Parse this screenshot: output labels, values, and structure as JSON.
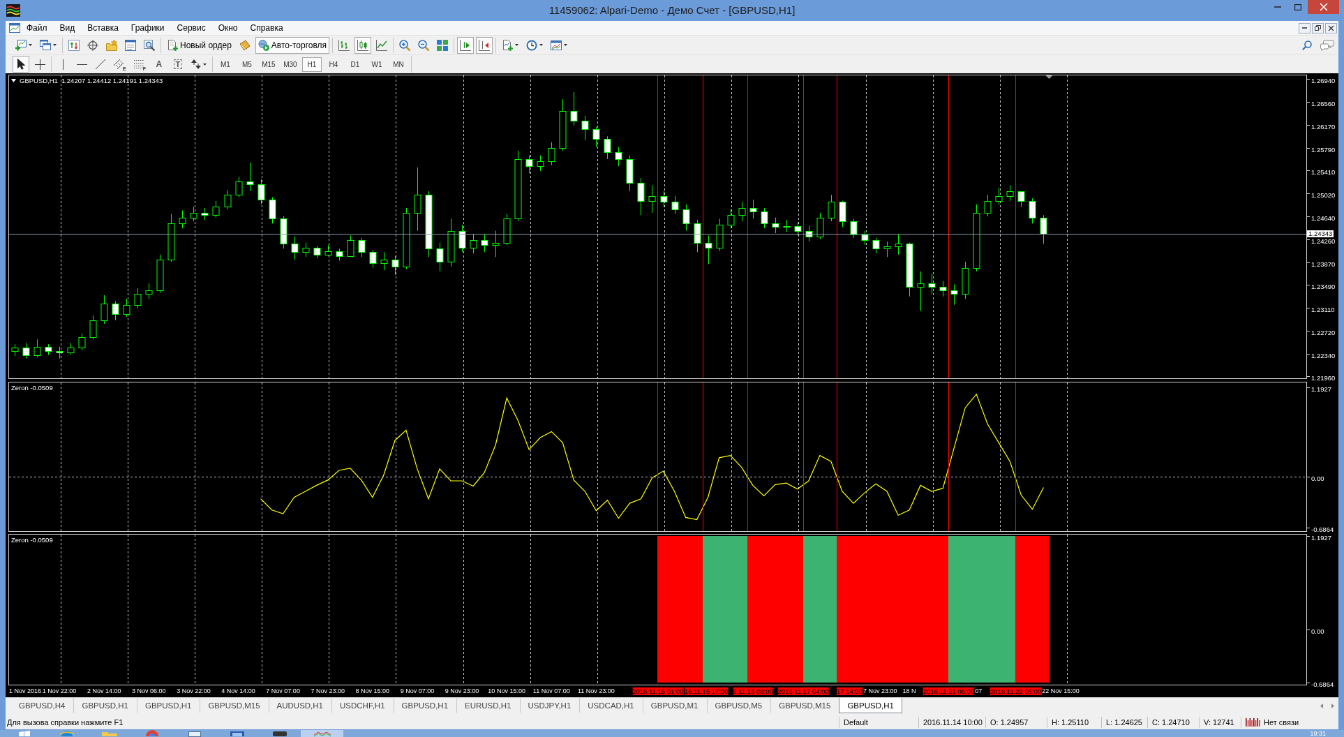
{
  "window": {
    "title": "11459062: Alpari-Demo - Демо Счет - [GBPUSD,H1]"
  },
  "menu": [
    "Файл",
    "Вид",
    "Вставка",
    "Графики",
    "Сервис",
    "Окно",
    "Справка"
  ],
  "main_toolbar": [
    [
      {
        "pressed": false,
        "dropdown": true
      },
      {
        "pressed": false,
        "dropdown": true
      }
    ],
    [
      {
        "pressed": false
      },
      {
        "pressed": false
      },
      {
        "pressed": false
      },
      {
        "pressed": false
      },
      {
        "pressed": false
      }
    ],
    [
      {
        "label": "Новый ордер",
        "pressed": false
      },
      {
        "pressed": false
      },
      {
        "label": "Авто-торговля",
        "pressed": true
      }
    ],
    [
      {
        "pressed": false
      },
      {
        "pressed": true
      },
      {
        "pressed": false
      }
    ],
    [
      {
        "pressed": false
      },
      {
        "pressed": false
      },
      {
        "pressed": false
      }
    ],
    [
      {
        "pressed": true
      },
      {
        "pressed": true
      }
    ],
    [
      {
        "pressed": false,
        "dropdown": true
      },
      {
        "pressed": false,
        "dropdown": true
      },
      {
        "pressed": false,
        "dropdown": true
      }
    ]
  ],
  "drawing_toolbar": [
    [
      {
        "pressed": true
      },
      {
        "pressed": false
      }
    ],
    [
      {
        "pressed": false
      },
      {
        "pressed": false
      },
      {
        "pressed": false
      },
      {
        "pressed": false,
        "label": "E"
      },
      {
        "pressed": false,
        "label": "F"
      },
      {
        "pressed": false,
        "label": "A"
      },
      {
        "pressed": false,
        "label": "T"
      },
      {
        "pressed": false,
        "dropdown": true
      }
    ]
  ],
  "timeframes": [
    {
      "label": "M1",
      "selected": false
    },
    {
      "label": "M5",
      "selected": false
    },
    {
      "label": "M15",
      "selected": false
    },
    {
      "label": "M30",
      "selected": false
    },
    {
      "label": "H1",
      "selected": true
    },
    {
      "label": "H4",
      "selected": false
    },
    {
      "label": "D1",
      "selected": false
    },
    {
      "label": "W1",
      "selected": false
    },
    {
      "label": "MN",
      "selected": false
    }
  ],
  "chart": {
    "chart_data": [
      {
        "type": "candlestick",
        "title": "GBPUSD,H1",
        "subtitle": "1.24207 1.24412 1.24191 1.24343",
        "color": "#00ff00",
        "ylim": [
          1.2193,
          1.27
        ],
        "grid": true,
        "yticks": [
          {
            "value": 1.2694,
            "label": "1.26940"
          },
          {
            "value": 1.2656,
            "label": "1.26560"
          },
          {
            "value": 1.2617,
            "label": "1.26170"
          },
          {
            "value": 1.2579,
            "label": "1.25790"
          },
          {
            "value": 1.2541,
            "label": "1.25410"
          },
          {
            "value": 1.2502,
            "label": "1.25020"
          },
          {
            "value": 1.2464,
            "label": "1.24640"
          },
          {
            "value": 1.2426,
            "label": "1.24260"
          },
          {
            "value": 1.2387,
            "label": "1.23870"
          },
          {
            "value": 1.2349,
            "label": "1.23490"
          },
          {
            "value": 1.2311,
            "label": "1.23110"
          },
          {
            "value": 1.2272,
            "label": "1.22720"
          },
          {
            "value": 1.2234,
            "label": "1.22340"
          },
          {
            "value": 1.2196,
            "label": "1.21960"
          }
        ],
        "ohlc": [
          [
            1.2238,
            1.225,
            1.223,
            1.2244
          ],
          [
            1.2244,
            1.2252,
            1.2226,
            1.2232
          ],
          [
            1.2232,
            1.2258,
            1.2228,
            1.2246
          ],
          [
            1.2246,
            1.225,
            1.2232,
            1.2238
          ],
          [
            1.2238,
            1.2246,
            1.2226,
            1.2236
          ],
          [
            1.2236,
            1.2252,
            1.2232,
            1.2244
          ],
          [
            1.2244,
            1.2268,
            1.224,
            1.2262
          ],
          [
            1.2262,
            1.2298,
            1.2258,
            1.229
          ],
          [
            1.229,
            1.2332,
            1.2284,
            1.2318
          ],
          [
            1.2318,
            1.2322,
            1.229,
            1.23
          ],
          [
            1.23,
            1.2326,
            1.2296,
            1.2316
          ],
          [
            1.2316,
            1.2344,
            1.231,
            1.2334
          ],
          [
            1.2334,
            1.2352,
            1.2326,
            1.234
          ],
          [
            1.234,
            1.24,
            1.2336,
            1.2392
          ],
          [
            1.2392,
            1.2468,
            1.2388,
            1.2452
          ],
          [
            1.2452,
            1.2474,
            1.2444,
            1.2462
          ],
          [
            1.2462,
            1.248,
            1.2456,
            1.247
          ],
          [
            1.247,
            1.2478,
            1.2458,
            1.2466
          ],
          [
            1.2466,
            1.249,
            1.2462,
            1.248
          ],
          [
            1.248,
            1.2508,
            1.2476,
            1.25
          ],
          [
            1.25,
            1.253,
            1.2496,
            1.2522
          ],
          [
            1.2522,
            1.2554,
            1.2506,
            1.2518
          ],
          [
            1.2518,
            1.2526,
            1.2484,
            1.2492
          ],
          [
            1.2492,
            1.2496,
            1.2452,
            1.246
          ],
          [
            1.246,
            1.2464,
            1.241,
            1.2418
          ],
          [
            1.2418,
            1.243,
            1.2392,
            1.2404
          ],
          [
            1.2404,
            1.242,
            1.2396,
            1.2412
          ],
          [
            1.2412,
            1.2414,
            1.2394,
            1.24
          ],
          [
            1.24,
            1.2416,
            1.2398,
            1.2406
          ],
          [
            1.2406,
            1.241,
            1.239,
            1.2398
          ],
          [
            1.2398,
            1.2432,
            1.2396,
            1.2424
          ],
          [
            1.2424,
            1.2428,
            1.2396,
            1.2404
          ],
          [
            1.2404,
            1.2408,
            1.2378,
            1.2386
          ],
          [
            1.2386,
            1.2404,
            1.2374,
            1.2392
          ],
          [
            1.2392,
            1.2398,
            1.2366,
            1.238
          ],
          [
            1.238,
            1.2478,
            1.2376,
            1.247
          ],
          [
            1.247,
            1.2546,
            1.244,
            1.25
          ],
          [
            1.25,
            1.2506,
            1.2396,
            1.241
          ],
          [
            1.241,
            1.242,
            1.2372,
            1.2388
          ],
          [
            1.2388,
            1.246,
            1.238,
            1.244
          ],
          [
            1.244,
            1.245,
            1.2404,
            1.2412
          ],
          [
            1.2412,
            1.2434,
            1.2402,
            1.2424
          ],
          [
            1.2424,
            1.2434,
            1.2404,
            1.2416
          ],
          [
            1.2416,
            1.244,
            1.2396,
            1.242
          ],
          [
            1.242,
            1.2468,
            1.2416,
            1.246
          ],
          [
            1.246,
            1.2574,
            1.2456,
            1.256
          ],
          [
            1.256,
            1.2566,
            1.2536,
            1.2548
          ],
          [
            1.2548,
            1.2566,
            1.254,
            1.2556
          ],
          [
            1.2556,
            1.2588,
            1.255,
            1.2578
          ],
          [
            1.2578,
            1.266,
            1.2574,
            1.264
          ],
          [
            1.264,
            1.2672,
            1.2616,
            1.2624
          ],
          [
            1.2624,
            1.2632,
            1.2592,
            1.261
          ],
          [
            1.261,
            1.2614,
            1.258,
            1.2594
          ],
          [
            1.2594,
            1.2598,
            1.256,
            1.2572
          ],
          [
            1.2572,
            1.258,
            1.2548,
            1.256
          ],
          [
            1.256,
            1.2566,
            1.2506,
            1.252
          ],
          [
            1.252,
            1.2528,
            1.2466,
            1.249
          ],
          [
            1.249,
            1.2516,
            1.247,
            1.2498
          ],
          [
            1.2498,
            1.2506,
            1.248,
            1.2488
          ],
          [
            1.2488,
            1.2498,
            1.2468,
            1.2476
          ],
          [
            1.2476,
            1.2484,
            1.244,
            1.2452
          ],
          [
            1.2452,
            1.2458,
            1.2404,
            1.242
          ],
          [
            1.242,
            1.2432,
            1.2384,
            1.2412
          ],
          [
            1.2412,
            1.246,
            1.2406,
            1.245
          ],
          [
            1.245,
            1.2476,
            1.2444,
            1.2466
          ],
          [
            1.2466,
            1.2488,
            1.2456,
            1.2478
          ],
          [
            1.2478,
            1.2492,
            1.246,
            1.2472
          ],
          [
            1.2472,
            1.2478,
            1.2444,
            1.2452
          ],
          [
            1.2452,
            1.2462,
            1.2436,
            1.2446
          ],
          [
            1.2446,
            1.2458,
            1.2438,
            1.2448
          ],
          [
            1.2448,
            1.2454,
            1.2432,
            1.244
          ],
          [
            1.244,
            1.2448,
            1.2422,
            1.243
          ],
          [
            1.243,
            1.247,
            1.2426,
            1.2462
          ],
          [
            1.2462,
            1.25,
            1.2456,
            1.2488
          ],
          [
            1.2488,
            1.249,
            1.2446,
            1.2456
          ],
          [
            1.2456,
            1.246,
            1.2428,
            1.2434
          ],
          [
            1.2434,
            1.244,
            1.2416,
            1.2424
          ],
          [
            1.2424,
            1.2428,
            1.2402,
            1.241
          ],
          [
            1.241,
            1.2422,
            1.2396,
            1.2414
          ],
          [
            1.2414,
            1.2434,
            1.24,
            1.2418
          ],
          [
            1.2418,
            1.242,
            1.233,
            1.2346
          ],
          [
            1.2346,
            1.2372,
            1.2306,
            1.2352
          ],
          [
            1.2352,
            1.2368,
            1.2334,
            1.2346
          ],
          [
            1.2346,
            1.2356,
            1.233,
            1.234
          ],
          [
            1.234,
            1.235,
            1.2316,
            1.2334
          ],
          [
            1.2334,
            1.2388,
            1.2326,
            1.2378
          ],
          [
            1.2378,
            1.2484,
            1.2372,
            1.247
          ],
          [
            1.247,
            1.25,
            1.2464,
            1.249
          ],
          [
            1.249,
            1.2512,
            1.2484,
            1.2498
          ],
          [
            1.2498,
            1.2516,
            1.249,
            1.2506
          ],
          [
            1.2506,
            1.2506,
            1.248,
            1.249
          ],
          [
            1.249,
            1.2494,
            1.2452,
            1.2462
          ],
          [
            1.2462,
            1.2466,
            1.2418,
            1.24343
          ],
          null,
          null,
          null,
          null,
          null,
          null,
          null,
          null,
          null,
          null,
          null,
          null,
          null,
          null,
          null,
          null,
          null,
          null,
          null,
          null,
          null,
          null,
          null
        ],
        "ref_lines": [
          {
            "axis": "y",
            "value": 1.24343,
            "label": "1.24343",
            "color": "#8a9bb0"
          }
        ]
      },
      {
        "type": "line",
        "title": "Zeron -0.0509",
        "color": "#ffff00",
        "ylim": [
          -0.733,
          1.258
        ],
        "grid": true,
        "yticks": [
          {
            "value": 1.1927,
            "label": "1.1927"
          },
          {
            "value": 0,
            "label": "0.00"
          },
          {
            "value": -0.6864,
            "label": "-0.6864"
          }
        ],
        "values": [
          null,
          null,
          null,
          null,
          null,
          null,
          null,
          null,
          null,
          null,
          null,
          null,
          null,
          null,
          null,
          null,
          null,
          null,
          null,
          null,
          null,
          null,
          -0.3,
          -0.45,
          -0.5,
          -0.28,
          -0.2,
          -0.12,
          -0.05,
          0.08,
          0.11,
          -0.05,
          -0.28,
          0.02,
          0.48,
          0.62,
          0.1,
          -0.3,
          0.1,
          -0.06,
          -0.06,
          -0.13,
          0.05,
          0.42,
          1.05,
          0.75,
          0.36,
          0.52,
          0.6,
          0.45,
          -0.05,
          -0.2,
          -0.46,
          -0.32,
          -0.56,
          -0.36,
          -0.3,
          -0.02,
          0.07,
          -0.2,
          -0.55,
          -0.58,
          -0.28,
          0.25,
          0.28,
          0.12,
          -0.12,
          -0.26,
          -0.11,
          -0.09,
          -0.17,
          -0.06,
          0.28,
          0.2,
          -0.2,
          -0.36,
          -0.22,
          -0.1,
          -0.2,
          -0.52,
          -0.45,
          -0.12,
          -0.2,
          -0.16,
          0.38,
          0.92,
          1.1,
          0.7,
          0.45,
          0.2,
          -0.25,
          -0.44,
          -0.15,
          null,
          null,
          null,
          null,
          null,
          null,
          null,
          null,
          null,
          null,
          null,
          null,
          null,
          null,
          null,
          null,
          null,
          null,
          null,
          null,
          null,
          null,
          null
        ],
        "ref_lines": [
          {
            "axis": "y",
            "value": 0,
            "color": "#c8c8c8",
            "line_style": "dashed"
          }
        ]
      },
      {
        "type": "bar",
        "title": "Zeron -0.0509",
        "ylim": [
          -0.71,
          1.215
        ],
        "grid": true,
        "yticks": [
          {
            "value": 1.1927,
            "label": "1.1927"
          },
          {
            "value": 0,
            "label": "0.00"
          },
          {
            "value": -0.6864,
            "label": "-0.6864"
          }
        ],
        "categories": [
          "1 Nov 2016",
          null,
          null,
          null,
          "1 Nov 22:00",
          null,
          null,
          null,
          "2 Nov 14:00",
          null,
          null,
          null,
          "3 Nov 06:00",
          null,
          null,
          null,
          "3 Nov 22:00",
          null,
          null,
          null,
          "4 Nov 14:00",
          null,
          null,
          null,
          "7 Nov 07:00",
          null,
          null,
          null,
          "7 Nov 23:00",
          null,
          null,
          null,
          "8 Nov 15:00",
          null,
          null,
          null,
          "9 Nov 07:00",
          null,
          null,
          null,
          "9 Nov 23:00",
          null,
          null,
          null,
          "10 Nov 15:00",
          null,
          null,
          null,
          "11 Nov 07:00",
          null,
          null,
          null,
          "11 Nov 23:00",
          null,
          null,
          null,
          null,
          null,
          null,
          null,
          null,
          null,
          null,
          null,
          null,
          null,
          null,
          null,
          null,
          null,
          null,
          null,
          null,
          null,
          null,
          null,
          null,
          "7 Nov 23:00",
          null,
          null,
          "18 N",
          null,
          null,
          null,
          null,
          null,
          "07",
          null,
          null,
          null,
          null,
          null,
          null,
          "22 Nov 15:00",
          null,
          null,
          null,
          null,
          null,
          null,
          null,
          null,
          null,
          null,
          null,
          null,
          null,
          null,
          null,
          null,
          null,
          null,
          null,
          null,
          null,
          null
        ],
        "values": [
          null,
          null,
          null,
          null,
          null,
          null,
          null,
          null,
          null,
          null,
          null,
          null,
          null,
          null,
          null,
          null,
          null,
          null,
          null,
          null,
          null,
          null,
          null,
          null,
          null,
          null,
          null,
          null,
          null,
          null,
          null,
          null,
          null,
          null,
          null,
          null,
          null,
          null,
          null,
          null,
          null,
          null,
          null,
          null,
          null,
          null,
          null,
          null,
          null,
          null,
          null,
          null,
          null,
          null,
          null,
          null,
          null,
          null,
          1.88,
          1.88,
          1.88,
          1.88,
          1.88,
          1.88,
          1.88,
          1.88,
          1.88,
          1.88,
          1.88,
          1.88,
          1.88,
          1.88,
          1.88,
          1.88,
          1.88,
          1.88,
          1.88,
          1.88,
          1.88,
          1.88,
          1.88,
          1.88,
          1.88,
          1.88,
          1.88,
          1.88,
          1.88,
          1.88,
          1.88,
          1.88,
          1.88,
          1.88,
          1.88,
          null,
          null,
          null,
          null,
          null,
          null,
          null,
          null,
          null,
          null,
          null,
          null,
          null,
          null,
          null,
          null,
          null,
          null,
          null,
          null,
          null,
          null,
          null
        ],
        "base": [
          null,
          null,
          null,
          null,
          null,
          null,
          null,
          null,
          null,
          null,
          null,
          null,
          null,
          null,
          null,
          null,
          null,
          null,
          null,
          null,
          null,
          null,
          null,
          null,
          null,
          null,
          null,
          null,
          null,
          null,
          null,
          null,
          null,
          null,
          null,
          null,
          null,
          null,
          null,
          null,
          null,
          null,
          null,
          null,
          null,
          null,
          null,
          null,
          null,
          null,
          null,
          null,
          null,
          null,
          null,
          null,
          null,
          null,
          -0.6864,
          -0.6864,
          -0.6864,
          -0.6864,
          -0.6864,
          -0.6864,
          -0.6864,
          -0.6864,
          -0.6864,
          -0.6864,
          -0.6864,
          -0.6864,
          -0.6864,
          -0.6864,
          -0.6864,
          -0.6864,
          -0.6864,
          -0.6864,
          -0.6864,
          -0.6864,
          -0.6864,
          -0.6864,
          -0.6864,
          -0.6864,
          -0.6864,
          -0.6864,
          -0.6864,
          -0.6864,
          -0.6864,
          -0.6864,
          -0.6864,
          -0.6864,
          -0.6864,
          -0.6864,
          -0.6864,
          null,
          null,
          null,
          null,
          null,
          null,
          null,
          null,
          null,
          null,
          null,
          null,
          null,
          null,
          null,
          null,
          null,
          null,
          null,
          null,
          null,
          null,
          null
        ],
        "colors": [
          null,
          null,
          null,
          null,
          null,
          null,
          null,
          null,
          null,
          null,
          null,
          null,
          null,
          null,
          null,
          null,
          null,
          null,
          null,
          null,
          null,
          null,
          null,
          null,
          null,
          null,
          null,
          null,
          null,
          null,
          null,
          null,
          null,
          null,
          null,
          null,
          null,
          null,
          null,
          null,
          null,
          null,
          null,
          null,
          null,
          null,
          null,
          null,
          null,
          null,
          null,
          null,
          null,
          null,
          null,
          null,
          null,
          null,
          "#ff0000",
          "#ff0000",
          "#ff0000",
          "#ff0000",
          "#3cb371",
          "#3cb371",
          "#3cb371",
          "#3cb371",
          "#ff0000",
          "#ff0000",
          "#ff0000",
          "#ff0000",
          "#ff0000",
          "#3cb371",
          "#3cb371",
          "#3cb371",
          "#ff0000",
          "#ff0000",
          "#ff0000",
          "#ff0000",
          "#ff0000",
          "#ff0000",
          "#ff0000",
          "#ff0000",
          "#ff0000",
          "#ff0000",
          "#3cb371",
          "#3cb371",
          "#3cb371",
          "#3cb371",
          "#3cb371",
          "#3cb371",
          "#ff0000",
          "#ff0000",
          "#ff0000",
          null,
          null,
          null,
          null,
          null,
          null,
          null,
          null,
          null,
          null,
          null,
          null,
          null,
          null,
          null,
          null,
          null,
          null,
          null,
          null,
          null,
          null,
          null
        ],
        "annotations": [
          "2016.11.15 01:00",
          "16.11.15 17:00",
          "6.11.16 08:00",
          "2016.11.17 04:00",
          "17 14:00",
          "2016.11.21 06:00",
          "2016.11.22 05:00"
        ]
      }
    ]
  },
  "tabs": [
    {
      "label": "GBPUSD,H4",
      "selected": false
    },
    {
      "label": "GBPUSD,H1",
      "selected": false
    },
    {
      "label": "GBPUSD,H1",
      "selected": false
    },
    {
      "label": "GBPUSD,M15",
      "selected": false
    },
    {
      "label": "AUDUSD,H1",
      "selected": false
    },
    {
      "label": "USDCHF,H1",
      "selected": false
    },
    {
      "label": "GBPUSD,H1",
      "selected": false
    },
    {
      "label": "EURUSD,H1",
      "selected": false
    },
    {
      "label": "USDJPY,H1",
      "selected": false
    },
    {
      "label": "USDCAD,H1",
      "selected": false
    },
    {
      "label": "GBPUSD,M1",
      "selected": false
    },
    {
      "label": "GBPUSD,M5",
      "selected": false
    },
    {
      "label": "GBPUSD,M15",
      "selected": false
    },
    {
      "label": "GBPUSD,H1",
      "selected": true
    }
  ],
  "status_bar": {
    "help": "Для вызова справки нажмите F1",
    "fields": [
      "Default",
      "2016.11.14 10:00",
      "O: 1.24957",
      "H: 1.25110",
      "L: 1.24625",
      "C: 1.24710",
      "V: 12741"
    ],
    "connection": "Нет связи"
  },
  "taskbar": {
    "clock": "19:31"
  }
}
